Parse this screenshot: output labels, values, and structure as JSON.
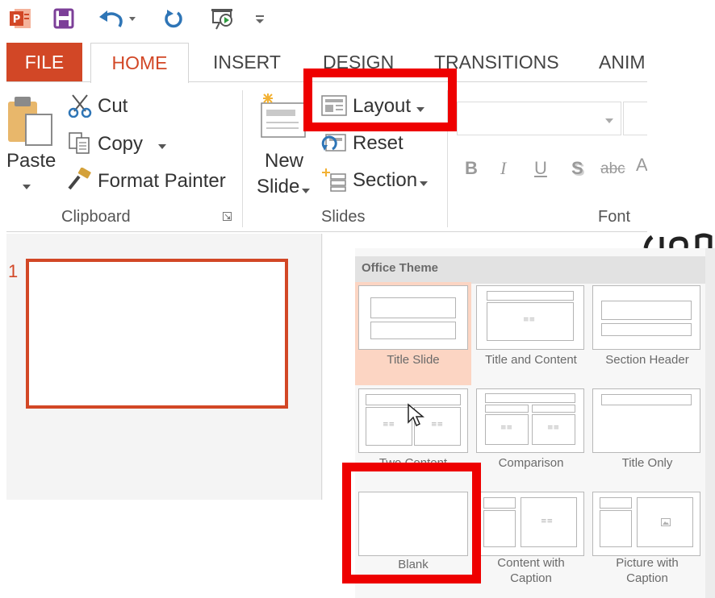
{
  "quick_access": {
    "icons": [
      "powerpoint-logo-icon",
      "save-icon",
      "undo-icon",
      "redo-icon",
      "slideshow-icon",
      "customize-icon"
    ]
  },
  "tabs": [
    {
      "label": "FILE",
      "selected": false
    },
    {
      "label": "HOME",
      "selected": true
    },
    {
      "label": "INSERT",
      "selected": false
    },
    {
      "label": "DESIGN",
      "selected": false
    },
    {
      "label": "TRANSITIONS",
      "selected": false
    },
    {
      "label": "ANIM",
      "selected": false
    }
  ],
  "clipboard": {
    "paste_label": "Paste",
    "cut_label": "Cut",
    "copy_label": "Copy",
    "format_painter_label": "Format Painter",
    "group_label": "Clipboard"
  },
  "slides": {
    "new_slide_line1": "New",
    "new_slide_line2": "Slide",
    "layout_label": "Layout",
    "reset_label": "Reset",
    "section_label": "Section",
    "group_label": "Slides"
  },
  "font": {
    "group_label": "Font",
    "bold": "B",
    "italic": "I",
    "underline": "U",
    "shadow": "S",
    "strikethrough": "abc"
  },
  "thumbnail_panel": {
    "slide_number": "1"
  },
  "layout_gallery": {
    "header": "Office Theme",
    "placeholder_text": "≡≡",
    "items": [
      {
        "label": "Title Slide",
        "selected": true
      },
      {
        "label": "Title and Content",
        "selected": false
      },
      {
        "label": "Section Header",
        "selected": false
      },
      {
        "label": "Two Content",
        "selected": false
      },
      {
        "label": "Comparison",
        "selected": false
      },
      {
        "label": "Title Only",
        "selected": false
      },
      {
        "label": "Blank",
        "selected": false
      },
      {
        "label": "Content with Caption",
        "label_line1": "Content with",
        "label_line2": "Caption",
        "selected": false
      },
      {
        "label": "Picture with Caption",
        "label_line1": "Picture with",
        "label_line2": "Caption",
        "selected": false
      }
    ]
  },
  "colors": {
    "accent": "#d24726",
    "highlight": "#ee0000",
    "selected_layout": "#fcd5c3"
  }
}
